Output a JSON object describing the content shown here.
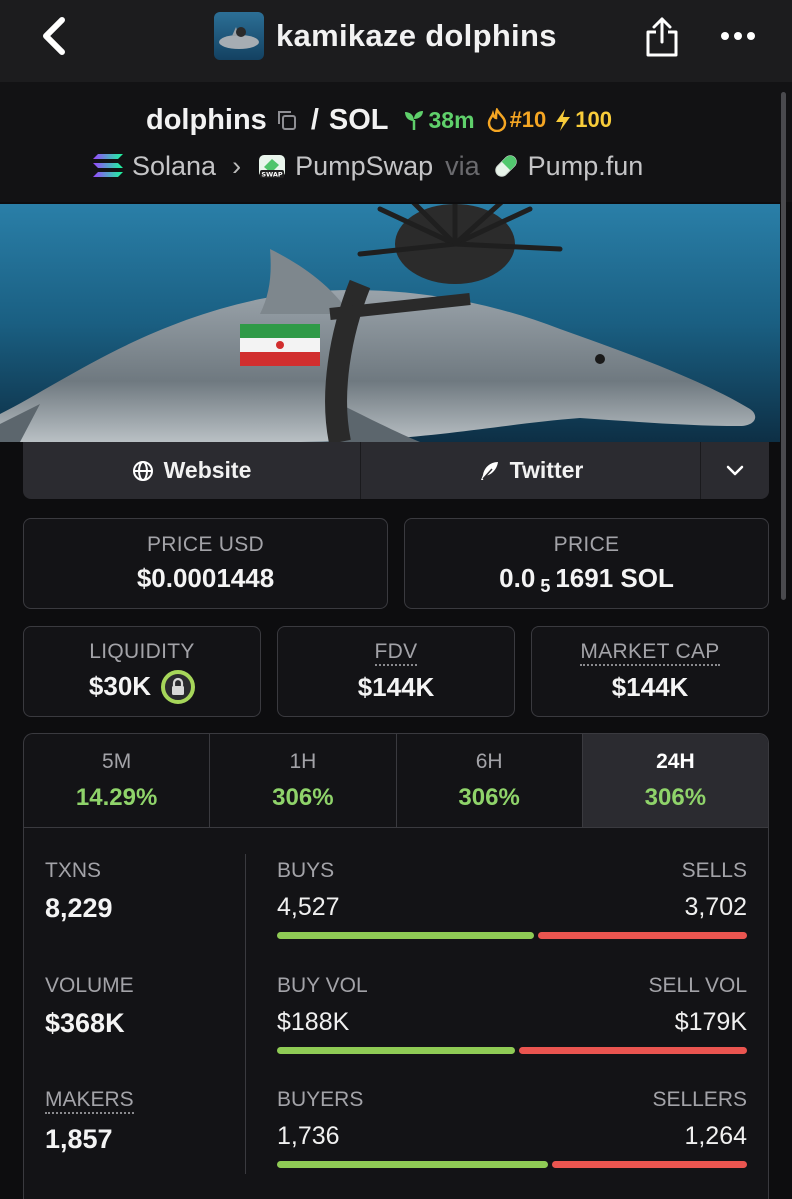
{
  "header": {
    "title": "kamikaze dolphins"
  },
  "pair": {
    "base": "dolphins",
    "separator": "/",
    "quote": "SOL",
    "age": "38m",
    "rank": "#10",
    "boost": "100",
    "chain": "Solana",
    "dex": "PumpSwap",
    "via_label": "via",
    "launchpad": "Pump.fun",
    "dex_badge_text": "SWAP"
  },
  "links": {
    "website_label": "Website",
    "twitter_label": "Twitter"
  },
  "prices": {
    "price_usd_label": "PRICE USD",
    "price_usd_value": "$0.0001448",
    "price_label": "PRICE",
    "price_prefix": "0.0",
    "price_zero_count": "5",
    "price_suffix": "1691 SOL"
  },
  "metrics": {
    "liquidity_label": "LIQUIDITY",
    "liquidity_value": "$30K",
    "fdv_label": "FDV",
    "fdv_value": "$144K",
    "mcap_label": "MARKET CAP",
    "mcap_value": "$144K"
  },
  "timeframes": [
    {
      "label": "5M",
      "change": "14.29%"
    },
    {
      "label": "1H",
      "change": "306%"
    },
    {
      "label": "6H",
      "change": "306%"
    },
    {
      "label": "24H",
      "change": "306%"
    }
  ],
  "active_timeframe": "24H",
  "stats": {
    "txns_label": "TXNS",
    "txns_value": "8,229",
    "volume_label": "VOLUME",
    "volume_value": "$368K",
    "makers_label": "MAKERS",
    "makers_value": "1,857",
    "buys_label": "BUYS",
    "buys_value": "4,527",
    "sells_label": "SELLS",
    "sells_value": "3,702",
    "buy_vol_label": "BUY VOL",
    "buy_vol_value": "$188K",
    "sell_vol_label": "SELL VOL",
    "sell_vol_value": "$179K",
    "buyers_label": "BUYERS",
    "buyers_value": "1,736",
    "sellers_label": "SELLERS",
    "sellers_value": "1,264"
  },
  "bars": {
    "txns_buy_fraction": 0.55,
    "vol_buy_fraction": 0.51,
    "makers_buy_fraction": 0.58
  },
  "colors": {
    "positive": "#8fd36a",
    "buy_bar": "#8fcb55",
    "sell_bar": "#ea5550",
    "age": "#5fd06b",
    "rank": "#f5a623",
    "boost": "#f8cc3a"
  }
}
